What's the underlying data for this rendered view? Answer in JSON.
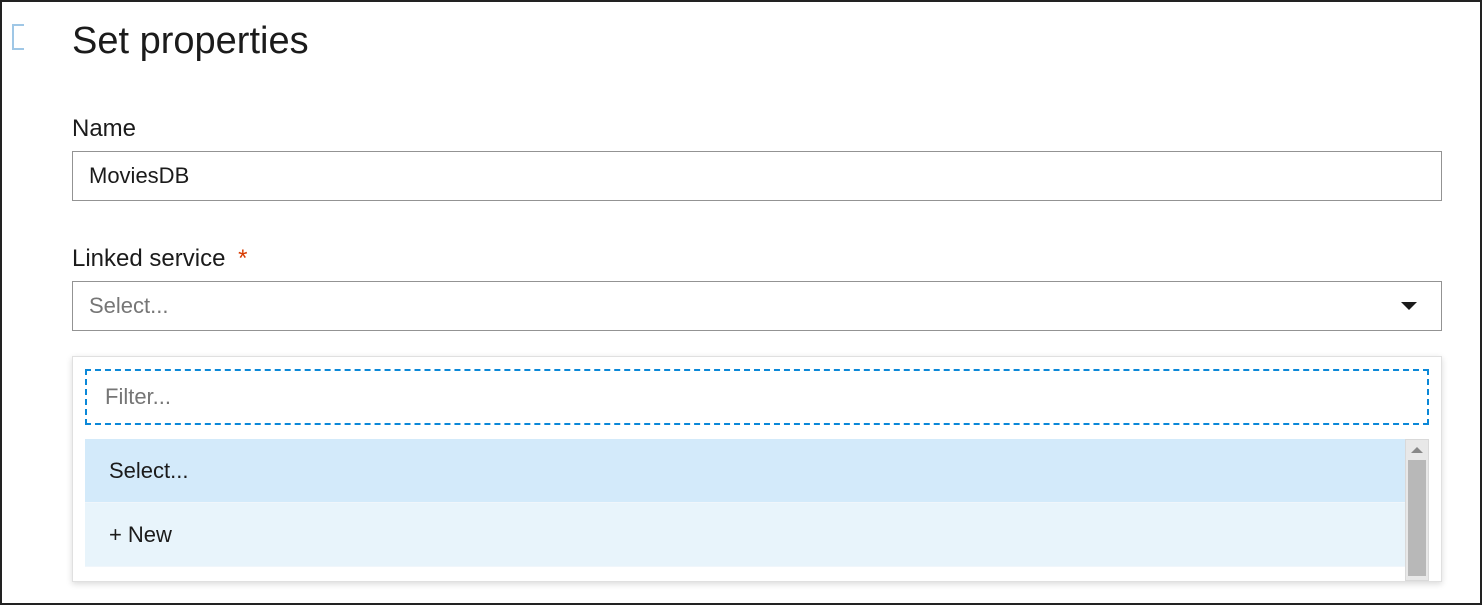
{
  "page": {
    "title": "Set properties"
  },
  "fields": {
    "name": {
      "label": "Name",
      "value": "MoviesDB"
    },
    "linked_service": {
      "label": "Linked service",
      "required_marker": "*",
      "placeholder": "Select..."
    }
  },
  "dropdown": {
    "filter_placeholder": "Filter...",
    "options": {
      "select": "Select...",
      "new_prefix": "+",
      "new_label": "New"
    }
  }
}
